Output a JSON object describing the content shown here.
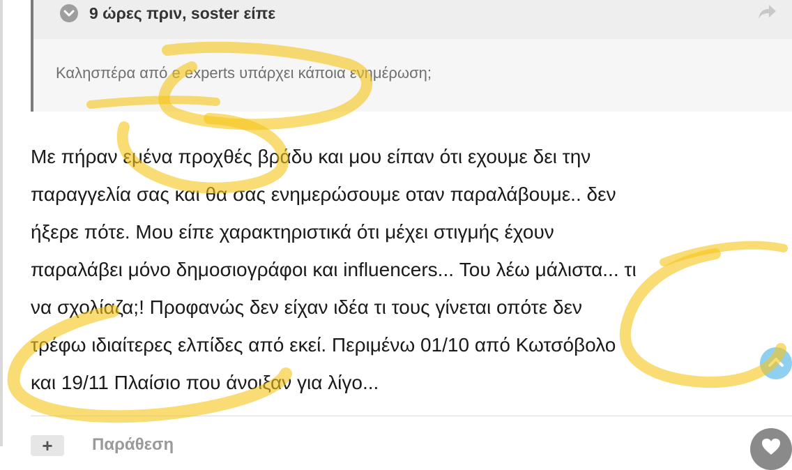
{
  "quote": {
    "author_line": "9 ώρες πριν, soster είπε",
    "text": "Καλησπέρα από e experts υπάρχει κάποια ενημέρωση;"
  },
  "post": {
    "lines": [
      "Με πήραν εμένα προχθές βράδυ και μου είπαν ότι εχουμε δει την",
      "παραγγελία σας και θα σας ενημερώσουμε οταν παραλάβουμε.. δεν",
      "ήξερε πότε. Μου είπε χαρακτηριστικά ότι μέχει στιγμής έχουν",
      "παραλάβει μόνο δημοσιογράφοι και influencers... Του λέω μάλιστα... τι",
      "να σχολίαζα;! Προφανώς δεν είχαν ιδέα τι τους γίνεται οπότε δεν",
      "τρέφω ιδιαίτερες ελπίδες από εκεί. Περιμένω 01/10 από Κωτσόβολο",
      "και 19/11 Πλαίσιο που άνοιξαν για λίγο..."
    ]
  },
  "footer": {
    "plus_label": "+",
    "label": "Παράθεση"
  },
  "icons": {
    "collapse": "chevron-down-icon",
    "share": "share-icon",
    "scroll_up": "chevron-up-icon",
    "reaction": "heart-icon"
  },
  "colors": {
    "highlighter": "#f5c518",
    "scroll_button": "#8fd0f0"
  }
}
